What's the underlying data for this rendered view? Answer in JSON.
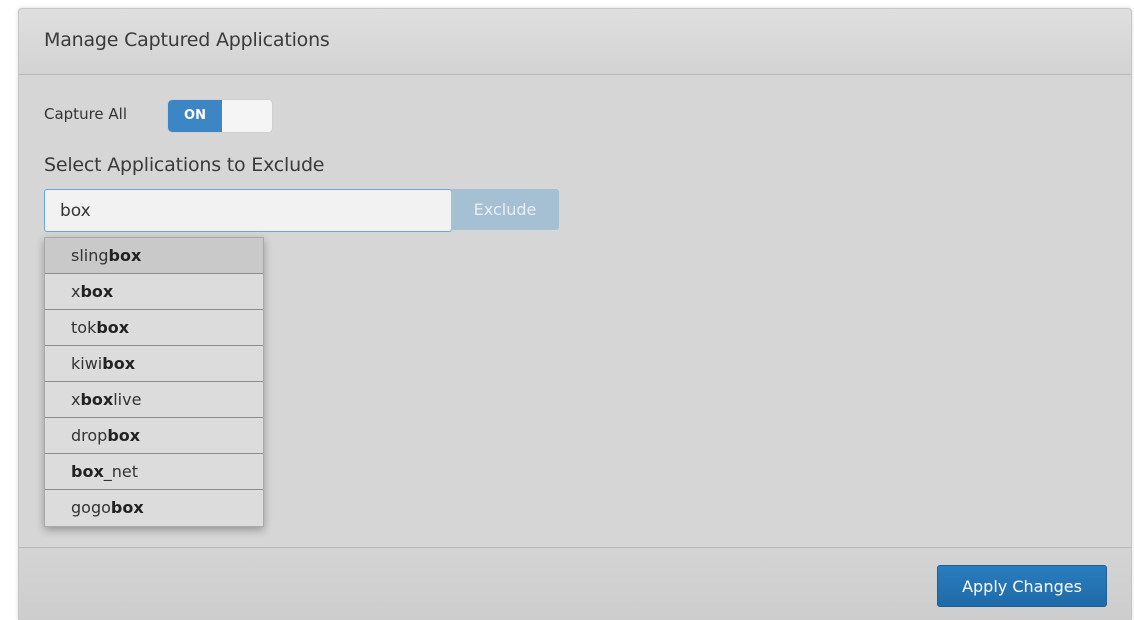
{
  "panel": {
    "title": "Manage Captured Applications"
  },
  "capture_all": {
    "label": "Capture All",
    "toggle_on_label": "ON",
    "state": "on"
  },
  "exclude": {
    "heading": "Select Applications to Exclude",
    "search_value": "box",
    "button_label": "Exclude"
  },
  "suggestions": [
    {
      "prefix": "sling",
      "match": "box",
      "suffix": ""
    },
    {
      "prefix": "x",
      "match": "box",
      "suffix": ""
    },
    {
      "prefix": "tok",
      "match": "box",
      "suffix": ""
    },
    {
      "prefix": "kiwi",
      "match": "box",
      "suffix": ""
    },
    {
      "prefix": "x",
      "match": "box",
      "suffix": "live"
    },
    {
      "prefix": "drop",
      "match": "box",
      "suffix": ""
    },
    {
      "prefix": "",
      "match": "box",
      "suffix": "_net"
    },
    {
      "prefix": "gogo",
      "match": "box",
      "suffix": ""
    }
  ],
  "footer": {
    "apply_label": "Apply Changes"
  },
  "colors": {
    "toggle_on": "#3d86c6",
    "apply_button": "#2a7dbf",
    "exclude_button_disabled": "#a5bfd3",
    "input_focus_border": "#6aa6dd"
  }
}
